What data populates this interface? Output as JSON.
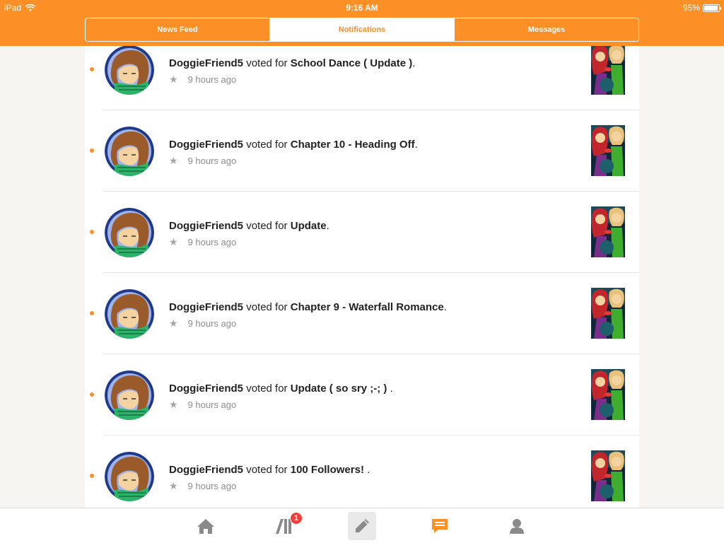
{
  "status_bar": {
    "device": "iPad",
    "time": "9:16 AM",
    "battery": "95%",
    "battery_level": 0.95
  },
  "tabs": [
    {
      "label": "News Feed",
      "active": false
    },
    {
      "label": "Notifications",
      "active": true
    },
    {
      "label": "Messages",
      "active": false
    }
  ],
  "notifications": [
    {
      "user": "DoggieFriend5",
      "verb": "voted for",
      "title": "School Dance ( Update )",
      "suffix": ".",
      "time": "9 hours ago"
    },
    {
      "user": "DoggieFriend5",
      "verb": "voted for",
      "title": "Chapter 10 - Heading Off",
      "suffix": ".",
      "time": "9 hours ago"
    },
    {
      "user": "DoggieFriend5",
      "verb": "voted for",
      "title": "Update",
      "suffix": ".",
      "time": "9 hours ago"
    },
    {
      "user": "DoggieFriend5",
      "verb": "voted for",
      "title": "Chapter 9 - Waterfall Romance",
      "suffix": ".",
      "time": "9 hours ago"
    },
    {
      "user": "DoggieFriend5",
      "verb": "voted for",
      "title": "Update ( so sry ;-; )",
      "suffix": " .",
      "time": "9 hours ago"
    },
    {
      "user": "DoggieFriend5",
      "verb": "voted for",
      "title": "100 Followers!",
      "suffix": " .",
      "time": "9 hours ago"
    }
  ],
  "tab_bar": {
    "items": [
      "home-icon",
      "library-icon",
      "write-icon",
      "notifications-icon",
      "profile-icon"
    ],
    "library_badge": "1"
  },
  "colors": {
    "accent": "#fd8f27",
    "badge": "#f03e3e"
  }
}
